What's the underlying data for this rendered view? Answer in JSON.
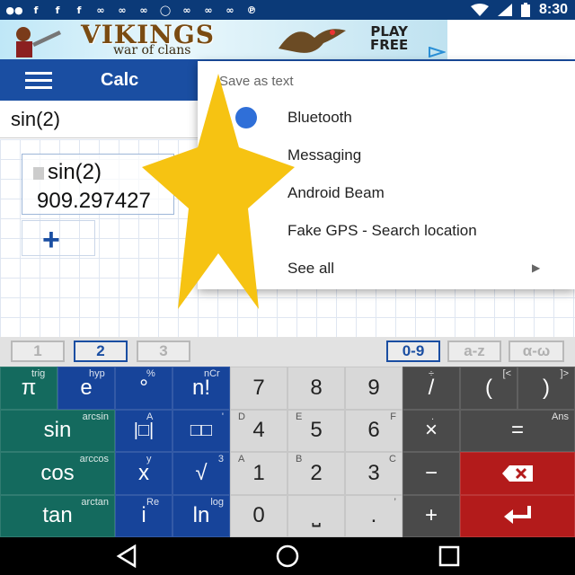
{
  "status_bar": {
    "time": "8:30",
    "notification_icons": [
      "chat-icon",
      "facebook-icon",
      "facebook-icon",
      "facebook-icon",
      "game-icon",
      "game-icon",
      "game-icon",
      "chat-bubble-icon",
      "game-icon",
      "game-icon",
      "game-icon",
      "pinterest-icon"
    ]
  },
  "ad": {
    "title": "VIKINGS",
    "subtitle": "war of clans",
    "cta_line1": "PLAY",
    "cta_line2": "FREE"
  },
  "toolbar": {
    "title": "Calc"
  },
  "input": {
    "value": "sin(2)"
  },
  "expression": {
    "text": "sin(2)",
    "result": "909.297427"
  },
  "menu": {
    "header": "Save as text",
    "items": [
      {
        "label": "Bluetooth"
      },
      {
        "label": "Messaging"
      },
      {
        "label": "Android Beam"
      },
      {
        "label": "Fake GPS - Search location"
      },
      {
        "label": "See all"
      }
    ]
  },
  "keyboard_tabs": {
    "t1": "1",
    "t2": "2",
    "t3": "3",
    "t4": "0-9",
    "t5": "a-z",
    "t6": "α-ω"
  },
  "keys": {
    "r1": [
      "π",
      "e",
      "°",
      "n!",
      "7",
      "8",
      "9",
      "/",
      "(",
      ")"
    ],
    "r1_sup": [
      "trig",
      "hyp",
      "%",
      "nCr",
      "",
      "",
      "",
      "÷",
      "[<",
      "]>"
    ],
    "r2": [
      "sin",
      "|□|",
      "□□",
      "4",
      "5",
      "6",
      "×",
      "="
    ],
    "r2_sup": [
      "arcsin",
      "A",
      "'",
      "D",
      "E",
      "F",
      ".",
      "Ans"
    ],
    "r3": [
      "cos",
      "x",
      "√",
      "1",
      "2",
      "3",
      "−"
    ],
    "r3_sup": [
      "arccos",
      "y",
      "3",
      "A",
      "B",
      "C",
      ""
    ],
    "r4": [
      "tan",
      "i",
      "ln",
      "0",
      "⎵",
      ".",
      "+"
    ],
    "r4_sup": [
      "arctan",
      "Re",
      "log",
      "",
      "",
      "’",
      ""
    ]
  },
  "colors": {
    "toolbar": "#1a4ea2",
    "green_key": "#146a5e",
    "blue_key": "#17449a",
    "red_key": "#b31b1b",
    "star": "#f6c312"
  }
}
